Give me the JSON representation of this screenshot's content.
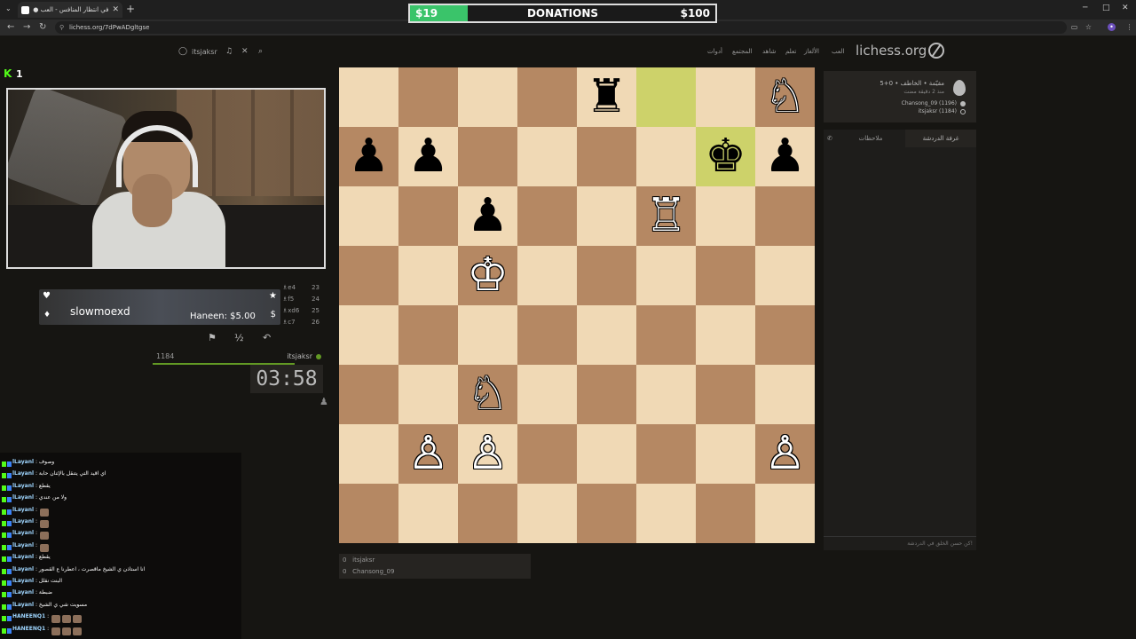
{
  "browser": {
    "tab_title": "في انتظار المنافس - العب ●org",
    "url": "lichess.org/7dPwADgltgse"
  },
  "donations": {
    "current": "$19",
    "title": "DONATIONS",
    "goal": "$100",
    "progress_fraction": 0.19,
    "color": "#3ac46a"
  },
  "header": {
    "logo": "lichess.org",
    "nav": [
      "العب",
      "الألغاز",
      "تعلم",
      "شاهد",
      "المجتمع",
      "أدوات"
    ],
    "user": "itsjaksr"
  },
  "stream": {
    "platform_icon": "kick-icon",
    "viewer_count": "1"
  },
  "alert": {
    "username": "slowmoexd",
    "donation": "Haneen: $5.00"
  },
  "moves": [
    {
      "num": "23",
      "move": "♗e4"
    },
    {
      "num": "24",
      "move": "♗f5"
    },
    {
      "num": "25",
      "move": "♗xd6"
    },
    {
      "num": "26",
      "move": "♗c7"
    }
  ],
  "player_bottom": {
    "rating": "1184",
    "name": "itsjaksr",
    "clock": "03:58"
  },
  "chat": [
    {
      "user": "lLayanl",
      "text": "وصوف"
    },
    {
      "user": "lLayanl",
      "text": "اي اقيد التي يتنقل بالإثنان حابة"
    },
    {
      "user": "lLayanl",
      "text": "يقطع"
    },
    {
      "user": "lLayanl",
      "text": "ولا من عندي"
    },
    {
      "user": "lLayanl",
      "text": "",
      "emojis": 1
    },
    {
      "user": "lLayanl",
      "text": "",
      "emojis": 1
    },
    {
      "user": "lLayanl",
      "text": "",
      "emojis": 1
    },
    {
      "user": "lLayanl",
      "text": "",
      "emojis": 1
    },
    {
      "user": "lLayanl",
      "text": "يقطع"
    },
    {
      "user": "lLayanl",
      "text": "انا استاذن ي الشيخ ماقصرت ، اعطرنا ع القصور"
    },
    {
      "user": "lLayanl",
      "text": "البنت نقلل"
    },
    {
      "user": "lLayanl",
      "text": "ضبطة"
    },
    {
      "user": "lLayanl",
      "text": "مسويت شي ي الشيخ"
    },
    {
      "user": "HANEENQ1",
      "text": "",
      "emojis": 3
    },
    {
      "user": "HANEENQ1",
      "text": "",
      "emojis": 3
    }
  ],
  "board": {
    "light_color": "#f0d9b5",
    "dark_color": "#b58863",
    "highlight_color": "#cdd26a",
    "orientation": "black",
    "pieces": [
      {
        "square": "g7",
        "glyph": "♙",
        "color": "white"
      },
      {
        "square": "f7",
        "glyph": "♙",
        "color": "white"
      },
      {
        "square": "a7",
        "glyph": "♙",
        "color": "white"
      },
      {
        "square": "f6",
        "glyph": "♘",
        "color": "white"
      },
      {
        "square": "f4",
        "glyph": "♔",
        "color": "white"
      },
      {
        "square": "f3",
        "glyph": "♟",
        "color": "black"
      },
      {
        "square": "c3",
        "glyph": "♖",
        "color": "white"
      },
      {
        "square": "h2",
        "glyph": "♟",
        "color": "black"
      },
      {
        "square": "g2",
        "glyph": "♟",
        "color": "black"
      },
      {
        "square": "b2",
        "glyph": "♚",
        "color": "black"
      },
      {
        "square": "a2",
        "glyph": "♟",
        "color": "black"
      },
      {
        "square": "d1",
        "glyph": "♜",
        "color": "black"
      },
      {
        "square": "a1",
        "glyph": "♘",
        "color": "white"
      }
    ],
    "highlights": [
      "c1",
      "b2"
    ]
  },
  "under_board": [
    {
      "score": "0",
      "name": "itsjaksr"
    },
    {
      "score": "0",
      "name": "Chansong_09"
    }
  ],
  "game_panel": {
    "line1": "5+0 • مقيّمة • الخاطف",
    "line2": "منذ 2 دقيقة مضت",
    "players": [
      {
        "name": "Chansong_09 (1196)",
        "dot": "#bababa"
      },
      {
        "name": "itsjaksr (1184)",
        "dot": "#262421"
      }
    ]
  },
  "chat_room": {
    "tab_chat": "غرفة الدردشة",
    "tab_notes": "ملاحظات",
    "placeholder": "كن حسن الخلق في الدردشة!"
  }
}
